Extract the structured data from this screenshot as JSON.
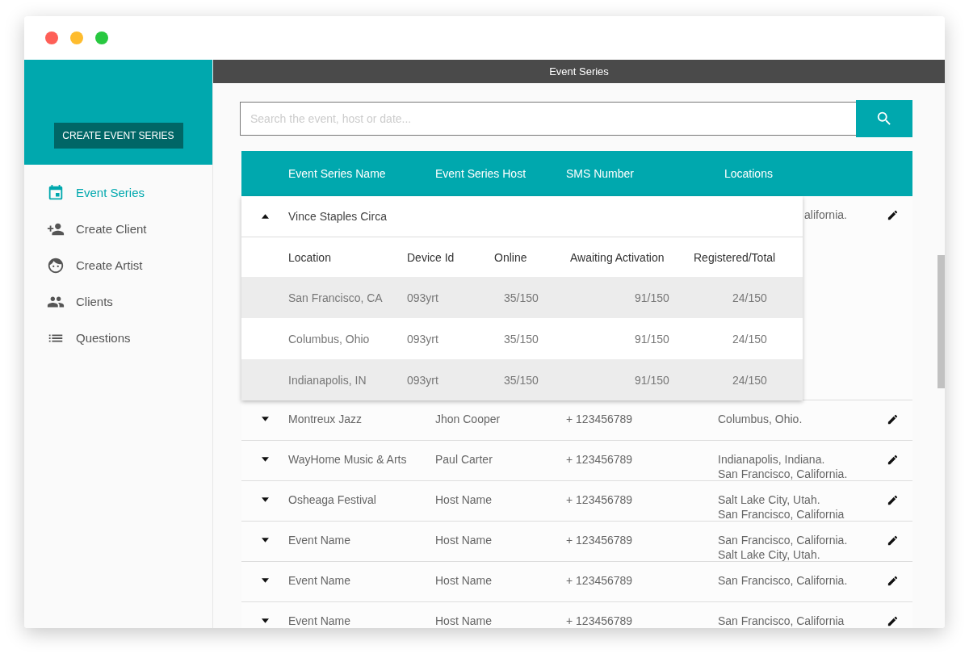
{
  "sidebar": {
    "create_button": "CREATE EVENT SERIES",
    "items": [
      {
        "label": "Event Series",
        "selected": true
      },
      {
        "label": "Create Client",
        "selected": false
      },
      {
        "label": "Create Artist",
        "selected": false
      },
      {
        "label": "Clients",
        "selected": false
      },
      {
        "label": "Questions",
        "selected": false
      }
    ]
  },
  "top_bar": {
    "title": "Event Series"
  },
  "search": {
    "placeholder": "Search the event, host or date..."
  },
  "table": {
    "columns": [
      "Event Series Name",
      "Event Series Host",
      "SMS Number",
      "Locations"
    ],
    "rows": [
      {
        "name": "Vince Staples Circa",
        "expanded": true,
        "locations": [
          "alifornia."
        ],
        "detail": {
          "columns": [
            "Location",
            "Device Id",
            "Online",
            "Awaiting Activation",
            "Registered/Total"
          ],
          "rows": [
            [
              "San Francisco, CA",
              "093yrt",
              "35/150",
              "91/150",
              "24/150"
            ],
            [
              "Columbus, Ohio",
              "093yrt",
              "35/150",
              "91/150",
              "24/150"
            ],
            [
              "Indianapolis, IN",
              "093yrt",
              "35/150",
              "91/150",
              "24/150"
            ]
          ]
        }
      },
      {
        "name": "Montreux Jazz",
        "host": "Jhon Cooper",
        "sms": "+ 123456789",
        "locations": [
          "Columbus, Ohio."
        ],
        "expanded": false
      },
      {
        "name": "WayHome Music & Arts",
        "host": "Paul Carter",
        "sms": "+ 123456789",
        "locations": [
          "Indianapolis, Indiana.",
          "San Francisco, California."
        ],
        "expanded": false
      },
      {
        "name": "Osheaga Festival",
        "host": "Host Name",
        "sms": "+ 123456789",
        "locations": [
          "Salt Lake City, Utah.",
          "San Francisco, California"
        ],
        "expanded": false
      },
      {
        "name": "Event Name",
        "host": "Host Name",
        "sms": "+ 123456789",
        "locations": [
          "San Francisco, California.",
          "Salt Lake City, Utah."
        ],
        "expanded": false
      },
      {
        "name": "Event Name",
        "host": "Host Name",
        "sms": "+ 123456789",
        "locations": [
          "San Francisco, California."
        ],
        "expanded": false
      },
      {
        "name": "Event Name",
        "host": "Host Name",
        "sms": "+ 123456789",
        "locations": [
          "San Francisco, California"
        ],
        "expanded": false
      }
    ]
  }
}
